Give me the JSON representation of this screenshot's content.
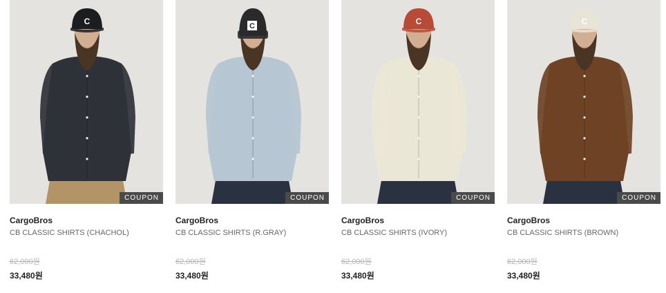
{
  "products": [
    {
      "brand": "CargoBros",
      "name": "CB CLASSIC SHIRTS (CHACHOL)",
      "original_price": "62,000원",
      "sale_price": "33,480원",
      "badge": "COUPON",
      "shirt_color": "#2e3138",
      "hat_color": "#1c1d21",
      "pants_color": "#b39466",
      "hat_type": "cap"
    },
    {
      "brand": "CargoBros",
      "name": "CB CLASSIC SHIRTS (R.GRAY)",
      "original_price": "62,000원",
      "sale_price": "33,480원",
      "badge": "COUPON",
      "shirt_color": "#b6c6d3",
      "hat_color": "#2a2a2c",
      "pants_color": "#2a3140",
      "hat_type": "beanie"
    },
    {
      "brand": "CargoBros",
      "name": "CB CLASSIC SHIRTS (IVORY)",
      "original_price": "62,000원",
      "sale_price": "33,480원",
      "badge": "COUPON",
      "shirt_color": "#ebe7d6",
      "hat_color": "#b84a38",
      "pants_color": "#2a3140",
      "hat_type": "cap"
    },
    {
      "brand": "CargoBros",
      "name": "CB CLASSIC SHIRTS (BROWN)",
      "original_price": "62,000원",
      "sale_price": "33,480원",
      "badge": "COUPON",
      "shirt_color": "#6e4224",
      "hat_color": "#e8e4d8",
      "pants_color": "#2a3140",
      "hat_type": "cap"
    }
  ]
}
